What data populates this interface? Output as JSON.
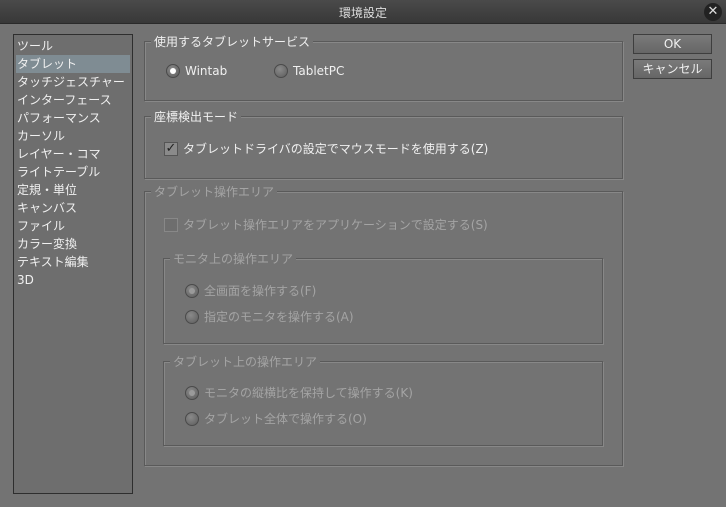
{
  "window": {
    "title": "環境設定"
  },
  "sidebar": {
    "items": [
      {
        "label": "ツール"
      },
      {
        "label": "タブレット",
        "selected": true
      },
      {
        "label": "タッチジェスチャー"
      },
      {
        "label": "インターフェース"
      },
      {
        "label": "パフォーマンス"
      },
      {
        "label": "カーソル"
      },
      {
        "label": "レイヤー・コマ"
      },
      {
        "label": "ライトテーブル"
      },
      {
        "label": "定規・単位"
      },
      {
        "label": "キャンバス"
      },
      {
        "label": "ファイル"
      },
      {
        "label": "カラー変換"
      },
      {
        "label": "テキスト編集"
      },
      {
        "label": "3D"
      }
    ]
  },
  "buttons": {
    "ok": "OK",
    "cancel": "キャンセル"
  },
  "service": {
    "legend": "使用するタブレットサービス",
    "wintab": "Wintab",
    "tabletpc": "TabletPC",
    "selected": "Wintab"
  },
  "coord": {
    "legend": "座標検出モード",
    "mouse_mode": "タブレットドライバの設定でマウスモードを使用する(Z)",
    "checked": true
  },
  "area": {
    "legend": "タブレット操作エリア",
    "app_setting": "タブレット操作エリアをアプリケーションで設定する(S)",
    "checked": false,
    "monitor": {
      "legend": "モニタ上の操作エリア",
      "full": "全画面を操作する(F)",
      "specified": "指定のモニタを操作する(A)",
      "selected": "full"
    },
    "tablet": {
      "legend": "タブレット上の操作エリア",
      "keep_ratio": "モニタの縦横比を保持して操作する(K)",
      "whole": "タブレット全体で操作する(O)",
      "selected": "keep_ratio"
    }
  }
}
